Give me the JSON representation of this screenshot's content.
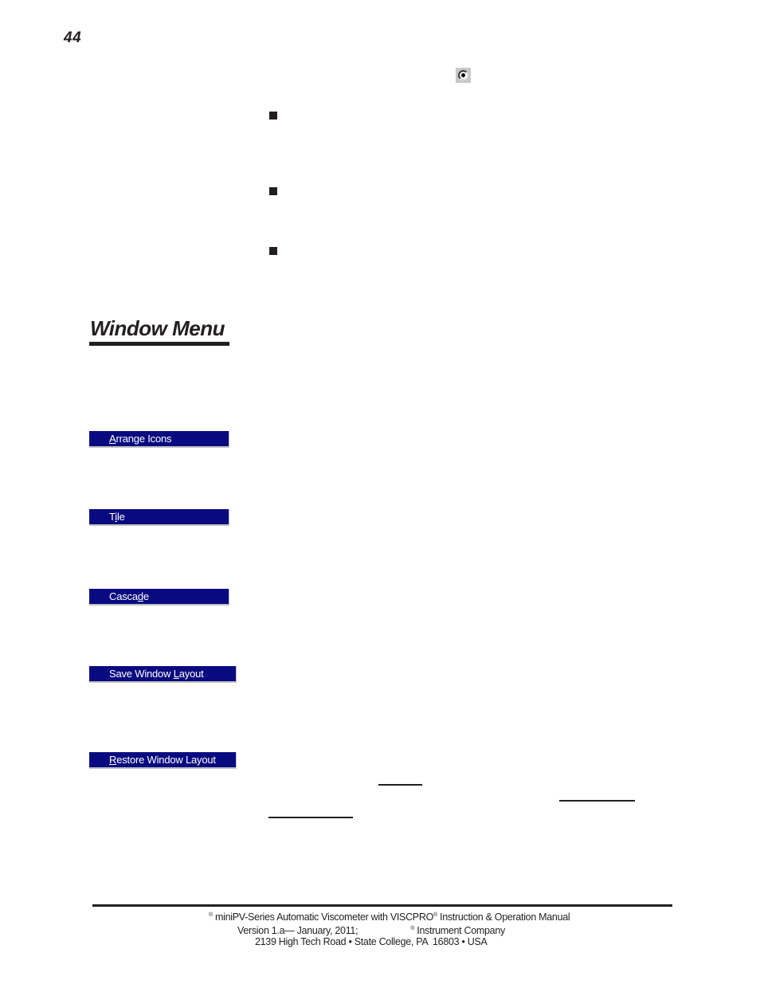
{
  "page": {
    "number": "44"
  },
  "icons": {
    "radio_button": "radio-button-selected-icon",
    "bullet": "square-bullet-icon"
  },
  "bullets": [
    {
      "text": ""
    },
    {
      "text": ""
    },
    {
      "text": ""
    }
  ],
  "section": {
    "title": "Window Menu"
  },
  "menu_items": [
    {
      "label": "Arrange Icons",
      "mnemonic": "A",
      "before": "",
      "after": "rrange Icons"
    },
    {
      "label": "Tile",
      "mnemonic": "i",
      "before": "T",
      "after": "le"
    },
    {
      "label": "Cascade",
      "mnemonic": "d",
      "before": "Casca",
      "after": "e"
    },
    {
      "label": "Save Window Layout",
      "mnemonic": "L",
      "before": "Save Window ",
      "after": "ayout"
    },
    {
      "label": "Restore Window Layout",
      "mnemonic": "R",
      "before": "",
      "after": "estore Window Layout"
    }
  ],
  "colors": {
    "menu_highlight": "#0a0a80",
    "menu_text": "#ffffff",
    "text": "#231f20"
  },
  "footer": {
    "line1_sup": "®",
    "line1_a": " miniPV-Series Automatic Viscometer with VISCPRO",
    "line1_sup2": "®",
    "line1_b": " Instruction & Operation Manual",
    "line2_a": "Version 1.a— January, 2011;",
    "line2_sup": "®",
    "line2_b": " Instrument Company",
    "line3": "2139 High Tech Road • State College, PA  16803 • USA"
  }
}
